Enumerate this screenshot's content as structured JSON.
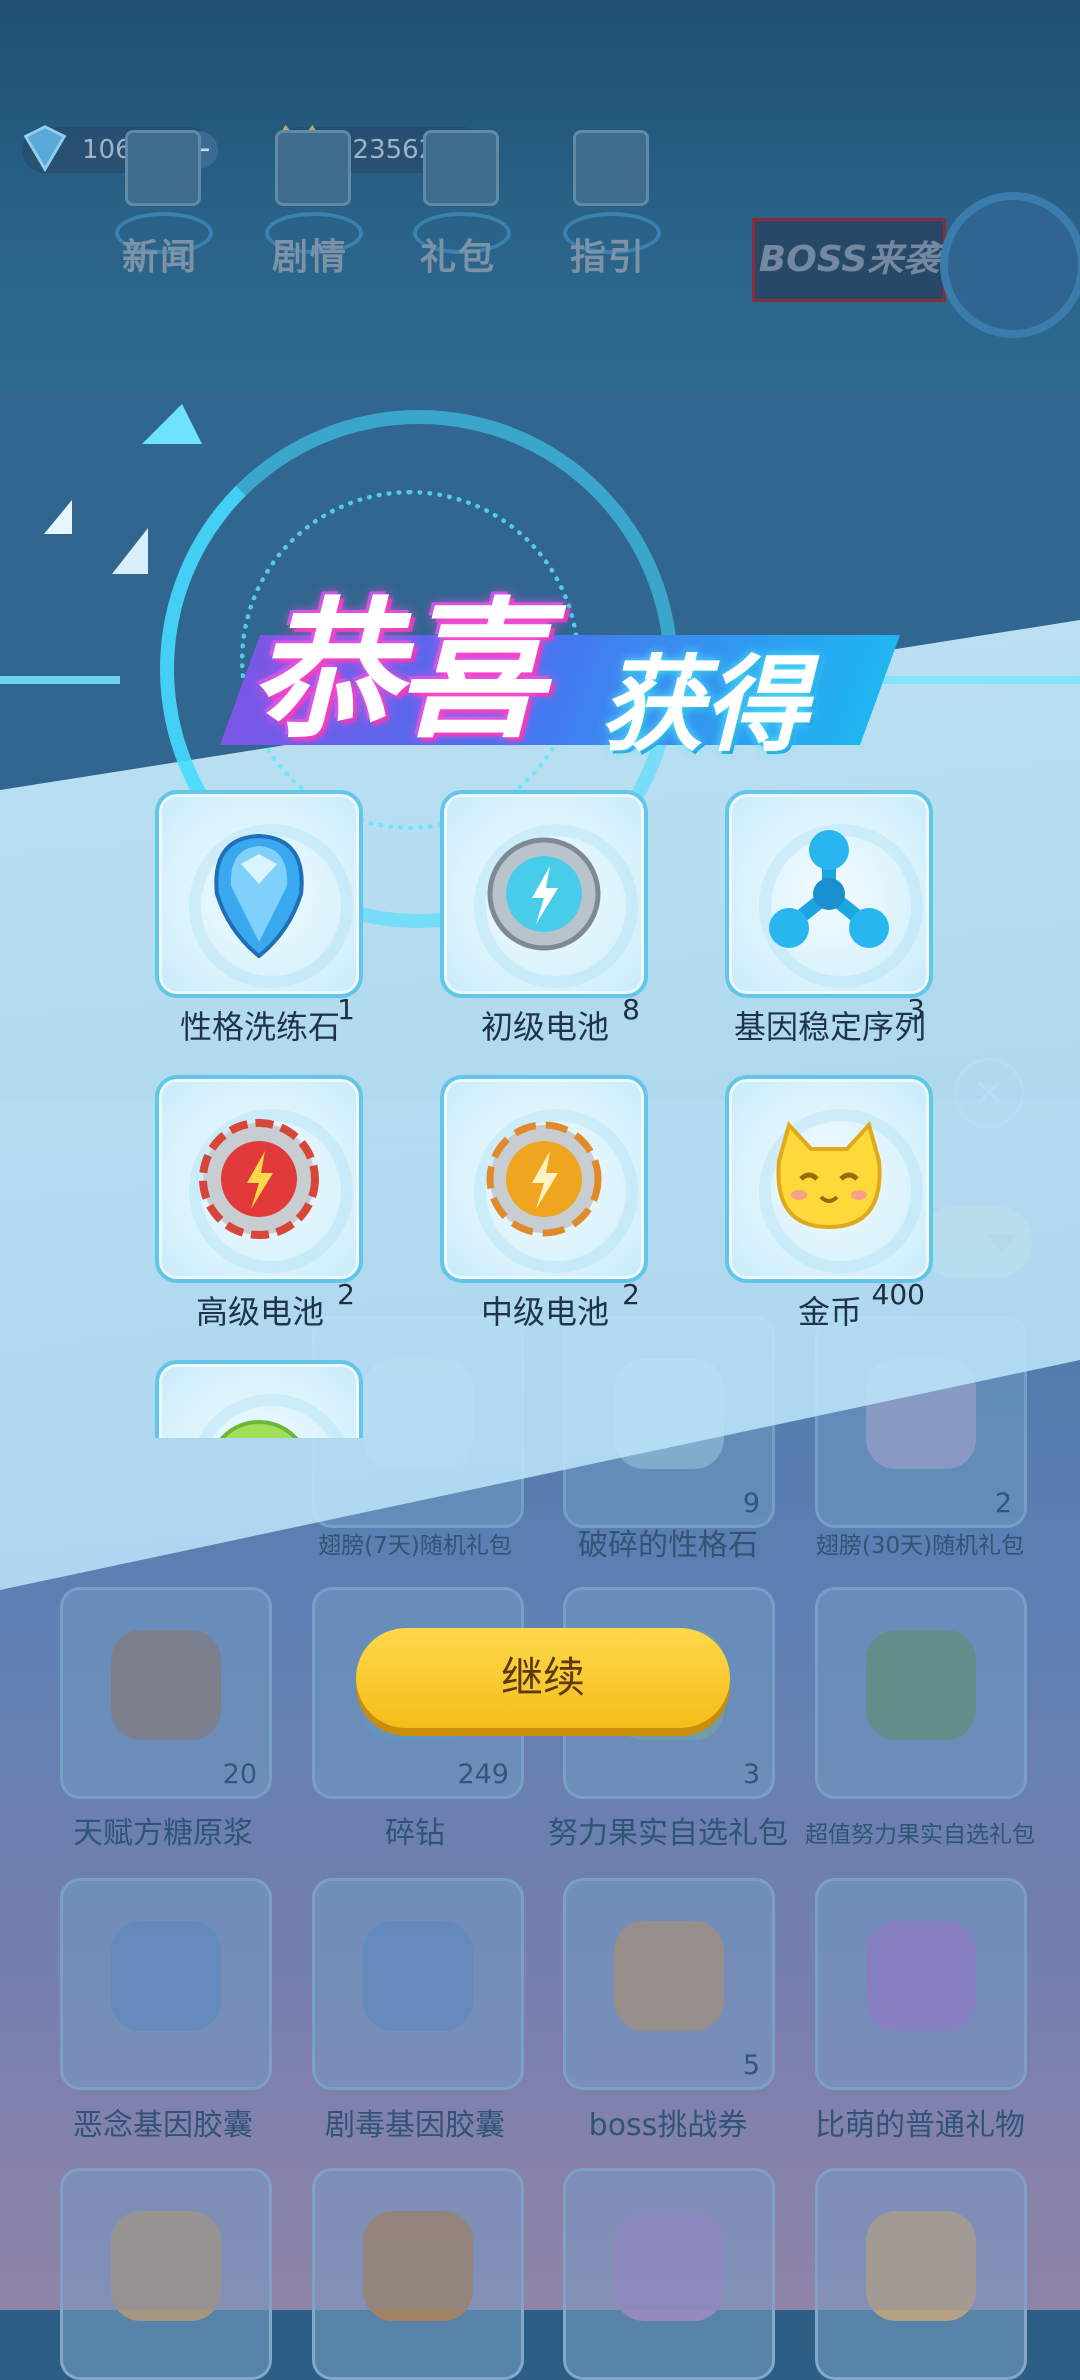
{
  "resources": {
    "diamond": {
      "amount": "106"
    },
    "coin": {
      "amount": "423562"
    }
  },
  "top_nav": {
    "items": [
      {
        "label": "新闻"
      },
      {
        "label": "剧情"
      },
      {
        "label": "礼包"
      },
      {
        "label": "指引"
      }
    ],
    "boss_label": "BOSS来袭"
  },
  "reward_dialog": {
    "title_main": "恭喜",
    "title_sub": "获得",
    "rewards": [
      {
        "name": "性格洗练石",
        "count": "1",
        "icon": "blue-gem-icon"
      },
      {
        "name": "初级电池",
        "count": "8",
        "icon": "silver-battery-icon"
      },
      {
        "name": "基因稳定序列",
        "count": "3",
        "icon": "gene-molecule-icon"
      },
      {
        "name": "高级电池",
        "count": "2",
        "icon": "red-battery-icon"
      },
      {
        "name": "中级电池",
        "count": "2",
        "icon": "gold-battery-icon"
      },
      {
        "name": "金币",
        "count": "400",
        "icon": "cat-coin-icon"
      },
      {
        "name": "",
        "count": "",
        "icon": "green-orb-icon"
      }
    ],
    "continue_label": "继续",
    "close_symbol": "×"
  },
  "inventory": {
    "row0": [
      {
        "name": "翅膀(7天)随机礼包",
        "count": ""
      },
      {
        "name": "破碎的性格石",
        "count": "9"
      },
      {
        "name": "翅膀(30天)随机礼包",
        "count": "2"
      }
    ],
    "row1": [
      {
        "name": "天赋方糖原浆",
        "count": "20"
      },
      {
        "name": "碎钻",
        "count": "249"
      },
      {
        "name": "努力果实自选礼包",
        "count": "3"
      },
      {
        "name": "超值努力果实自选礼包",
        "count": ""
      }
    ],
    "row2": [
      {
        "name": "恶念基因胶囊",
        "count": ""
      },
      {
        "name": "剧毒基因胶囊",
        "count": ""
      },
      {
        "name": "boss挑战券",
        "count": "5"
      },
      {
        "name": "比萌的普通礼物",
        "count": ""
      }
    ]
  },
  "colors": {
    "accent_cyan": "#3fd7ff",
    "button_yellow": "#f6bd1a",
    "title_pink": "#ff4fd8"
  }
}
